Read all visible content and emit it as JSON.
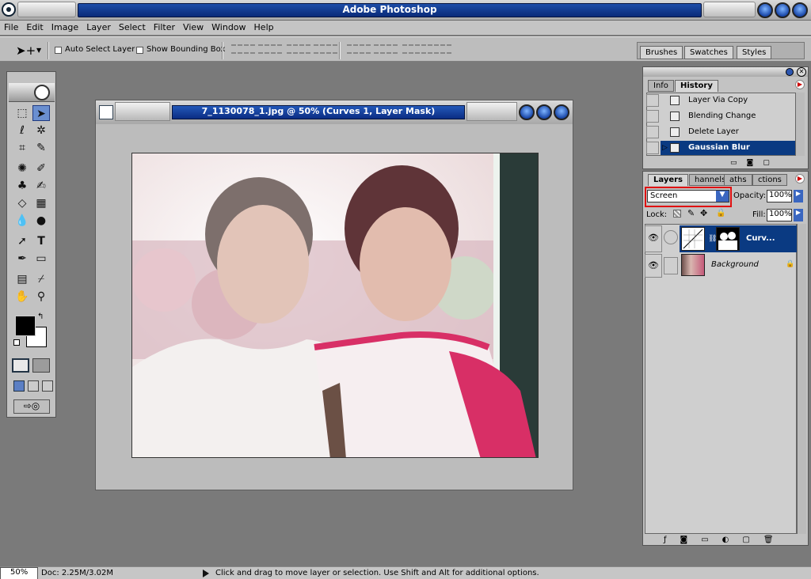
{
  "app": {
    "title": "Adobe Photoshop"
  },
  "menu": [
    "File",
    "Edit",
    "Image",
    "Layer",
    "Select",
    "Filter",
    "View",
    "Window",
    "Help"
  ],
  "options": {
    "auto_select": "Auto Select Layer",
    "bounding_box": "Show Bounding Box"
  },
  "palette_well": [
    "Brushes",
    "Swatches",
    "Styles"
  ],
  "document": {
    "title": "7_1130078_1.jpg @ 50% (Curves 1, Layer Mask)"
  },
  "history_palette": {
    "tabs": [
      "Info",
      "History"
    ],
    "items": [
      {
        "label": "Layer Via Copy",
        "selected": false
      },
      {
        "label": "Blending Change",
        "selected": false
      },
      {
        "label": "Delete Layer",
        "selected": false
      },
      {
        "label": "Gaussian Blur",
        "selected": true
      }
    ]
  },
  "layers_palette": {
    "tabs": [
      "Layers",
      "Channels",
      "Paths",
      "Actions"
    ],
    "tab_visible": [
      "Layers",
      "hannels",
      "aths",
      "ctions"
    ],
    "blend_mode": "Screen",
    "opacity_label": "Opacity:",
    "opacity": "100%",
    "lock_label": "Lock:",
    "fill_label": "Fill:",
    "fill": "100%",
    "layers": [
      {
        "name": "Curv...",
        "selected": true
      },
      {
        "name": "Background",
        "selected": false
      }
    ]
  },
  "status": {
    "zoom": "50%",
    "doc": "Doc: 2.25M/3.02M",
    "message": "Click and drag to move layer or selection.  Use Shift and Alt for additional options."
  },
  "colors": {
    "accent": "#0a3a82",
    "highlight_box": "#e01010"
  }
}
